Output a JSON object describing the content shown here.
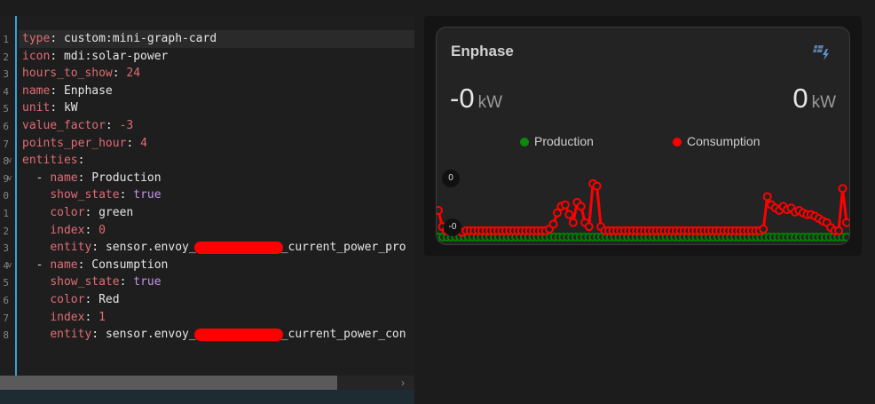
{
  "editor": {
    "lines": [
      {
        "key": "type",
        "value": "custom:mini-graph-card"
      },
      {
        "key": "icon",
        "value": "mdi:solar-power"
      },
      {
        "key": "hours_to_show",
        "value": "24"
      },
      {
        "key": "name",
        "value": "Enphase"
      },
      {
        "key": "unit",
        "value": "kW"
      },
      {
        "key": "value_factor",
        "value": "-3"
      },
      {
        "key": "points_per_hour",
        "value": "4"
      },
      {
        "key": "entities",
        "value": ""
      },
      {
        "key": "name",
        "value": "Production"
      },
      {
        "key": "show_state",
        "value": "true"
      },
      {
        "key": "color",
        "value": "green"
      },
      {
        "key": "index",
        "value": "0"
      },
      {
        "key": "entity",
        "value_prefix": "sensor.envoy_",
        "value_suffix": "_current_power_pro"
      },
      {
        "key": "name",
        "value": "Consumption"
      },
      {
        "key": "show_state",
        "value": "true"
      },
      {
        "key": "color",
        "value": "Red"
      },
      {
        "key": "index",
        "value": "1"
      },
      {
        "key": "entity",
        "value_prefix": "sensor.envoy_",
        "value_suffix": "_current_power_con"
      }
    ]
  },
  "card": {
    "title": "Enphase",
    "icon": "solar-power-icon",
    "state_left": {
      "value": "-0",
      "unit": "kW"
    },
    "state_right": {
      "value": "0",
      "unit": "kW"
    },
    "legend": [
      {
        "label": "Production",
        "color": "#0a8a0a"
      },
      {
        "label": "Consumption",
        "color": "#ff0000"
      }
    ],
    "bound_top": "0",
    "bound_bottom": "-0"
  },
  "chart_data": {
    "type": "line",
    "series": [
      {
        "name": "Production",
        "color": "#008000",
        "values": [
          0,
          0,
          0,
          0,
          0,
          0,
          0,
          0,
          0,
          0,
          0,
          0,
          0,
          0,
          0,
          0,
          0,
          0,
          0,
          0,
          0,
          0,
          0,
          0,
          0,
          0,
          0,
          0,
          0,
          0,
          0,
          0,
          0,
          0,
          0,
          0,
          0,
          0,
          0,
          0,
          0,
          0,
          0,
          0,
          0,
          0,
          0,
          0,
          0,
          0,
          0,
          0,
          0,
          0,
          0,
          0,
          0,
          0,
          0,
          0,
          0,
          0,
          0,
          0,
          0,
          0,
          0,
          0,
          0,
          0,
          0,
          0,
          0,
          0,
          0,
          0,
          0,
          0,
          0,
          0,
          0,
          0,
          0,
          0,
          0,
          0,
          0,
          0,
          0,
          0,
          0,
          0,
          0,
          0,
          0,
          0
        ]
      },
      {
        "name": "Consumption",
        "color": "#ff0000",
        "values": [
          0.35,
          0.15,
          0.1,
          0.12,
          0.14,
          0.1,
          0.08,
          0.1,
          0.1,
          0.1,
          0.1,
          0.1,
          0.1,
          0.1,
          0.1,
          0.1,
          0.1,
          0.1,
          0.1,
          0.1,
          0.1,
          0.1,
          0.1,
          0.1,
          0.1,
          0.1,
          0.1,
          0.1,
          0.12,
          0.18,
          0.32,
          0.4,
          0.42,
          0.3,
          0.2,
          0.45,
          0.4,
          0.2,
          0.15,
          0.68,
          0.65,
          0.15,
          0.1,
          0.1,
          0.1,
          0.1,
          0.1,
          0.1,
          0.1,
          0.1,
          0.1,
          0.1,
          0.1,
          0.1,
          0.1,
          0.1,
          0.1,
          0.1,
          0.1,
          0.1,
          0.1,
          0.1,
          0.1,
          0.1,
          0.1,
          0.1,
          0.1,
          0.1,
          0.1,
          0.1,
          0.1,
          0.1,
          0.1,
          0.1,
          0.1,
          0.1,
          0.1,
          0.1,
          0.1,
          0.1,
          0.1,
          0.1,
          0.12,
          0.52,
          0.42,
          0.38,
          0.35,
          0.4,
          0.36,
          0.38,
          0.33,
          0.35,
          0.32,
          0.3,
          0.3,
          0.28,
          0.25,
          0.22,
          0.2,
          0.14,
          0.1,
          0.1,
          0.62,
          0.2
        ]
      }
    ]
  }
}
